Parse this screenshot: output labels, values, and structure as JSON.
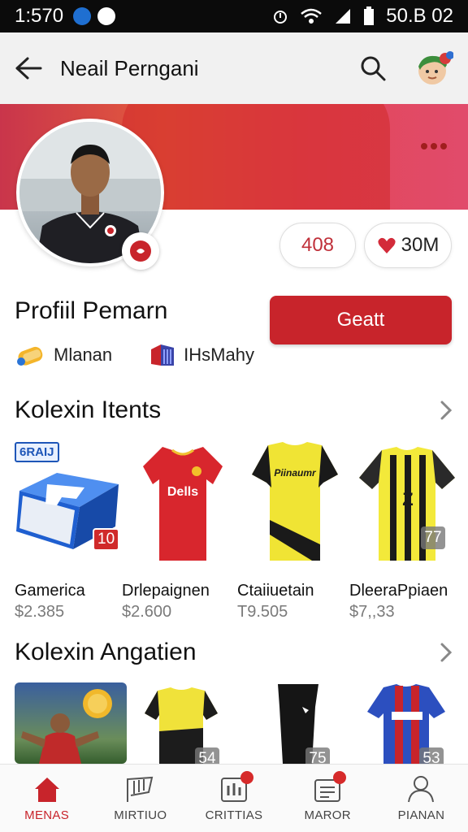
{
  "status_bar": {
    "time": "1:570",
    "right_text": "50.B 02"
  },
  "app_bar": {
    "title": "Neail Perngani"
  },
  "stats": {
    "count": "408",
    "likes": "30M"
  },
  "profile": {
    "title": "Profiil Pemarn",
    "primary_button": "Geatt",
    "meta": [
      {
        "label": "Mlanan",
        "icon": "ticket-icon"
      },
      {
        "label": "IHsMahy",
        "icon": "gift-icon"
      }
    ]
  },
  "section1": {
    "title": "Kolexin Itents",
    "tag": "6RAIJ",
    "items": [
      {
        "name": "Gamerica",
        "price": "$2.385",
        "badge": "10"
      },
      {
        "name": "Drlepaignen",
        "price": "$2.600",
        "badge": ""
      },
      {
        "name": "Ctaiiuetain",
        "price": "T9.505",
        "badge": ""
      },
      {
        "name": "DleeraPpiaen",
        "price": "$7,,33",
        "badge": "77"
      }
    ],
    "shirt_texts": [
      "Dells",
      "Piinaumr",
      "Z"
    ]
  },
  "section2": {
    "title": "Kolexin Angatien",
    "badges": [
      "",
      "54",
      "75",
      "53"
    ]
  },
  "nav": [
    {
      "label": "MENAS",
      "icon": "home-icon",
      "active": true,
      "dot": false
    },
    {
      "label": "MIRTIUO",
      "icon": "flag-icon",
      "active": false,
      "dot": false
    },
    {
      "label": "CRITTIAS",
      "icon": "chart-icon",
      "active": false,
      "dot": true
    },
    {
      "label": "MAROR",
      "icon": "wallet-icon",
      "active": false,
      "dot": true
    },
    {
      "label": "PIANAN",
      "icon": "person-icon",
      "active": false,
      "dot": false
    }
  ],
  "colors": {
    "brand_red": "#c8242b",
    "status_bar": "#0b0b0b",
    "app_bar": "#f1f1f1"
  }
}
